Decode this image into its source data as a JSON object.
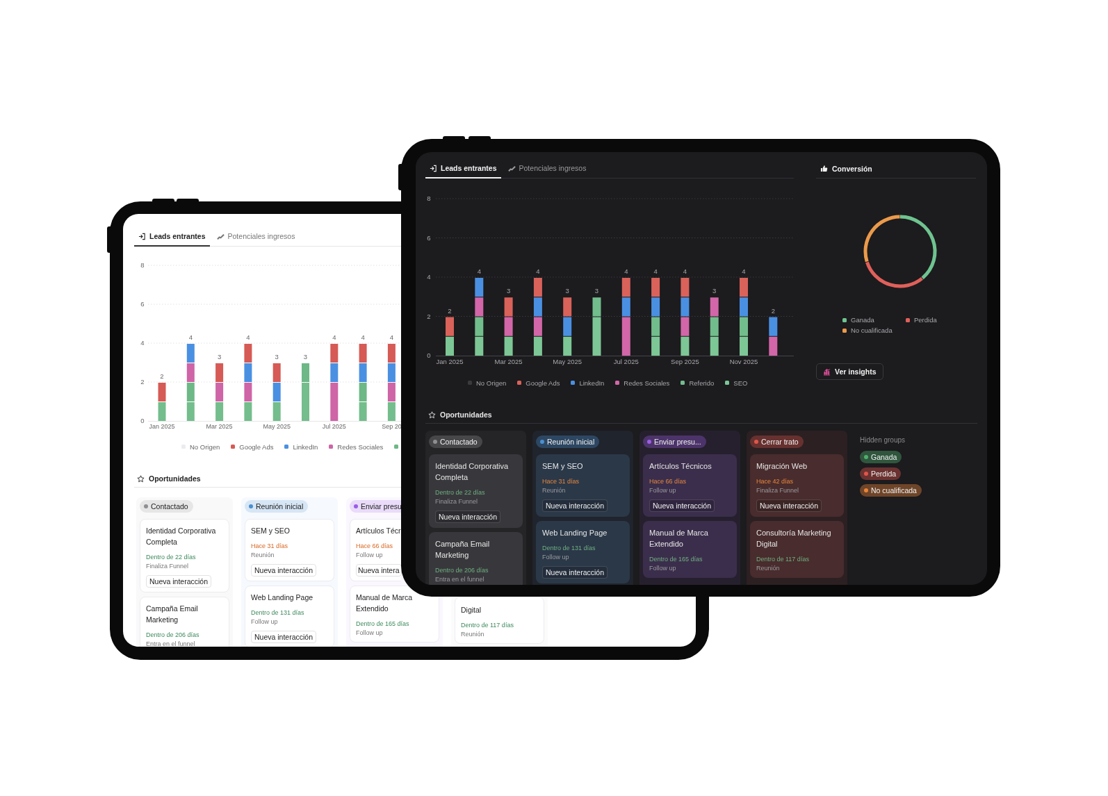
{
  "devices": [
    {
      "kind": "light",
      "tabs": [
        {
          "label": "Leads entrantes",
          "selected": true
        },
        {
          "label": "Potenciales ingresos",
          "selected": false
        }
      ],
      "chart": {
        "chart_data": {
          "type": "bar",
          "stacked": true,
          "grid": true,
          "legend": "bottom",
          "categories": [
            "Jan 2025",
            null,
            "Mar 2025",
            null,
            "May 2025",
            null,
            "Jul 2025",
            null,
            "Sep 20"
          ],
          "value_labels": [
            "2",
            "4",
            "3",
            "4",
            "3",
            "3",
            "4",
            "4",
            "4"
          ],
          "ylim": [
            0,
            8
          ],
          "yticks": [
            0,
            2,
            4,
            6,
            8
          ],
          "series": [
            {
              "name": "No Origen",
              "color": "#ececf0",
              "values": [
                0,
                0,
                0,
                0,
                0,
                0,
                0,
                0,
                0
              ]
            },
            {
              "name": "Google Ads",
              "color": "#d65a55",
              "values": [
                1,
                0,
                1,
                1,
                1,
                0,
                1,
                1,
                1
              ]
            },
            {
              "name": "LinkedIn",
              "color": "#4a90e2",
              "values": [
                0,
                1,
                0,
                1,
                1,
                0,
                1,
                1,
                1
              ]
            },
            {
              "name": "Redes Sociales",
              "color": "#cf64a6",
              "values": [
                0,
                1,
                1,
                1,
                0,
                0,
                2,
                0,
                1
              ]
            },
            {
              "color": "#6db886",
              "values": [
                0,
                1,
                0,
                0,
                0,
                1,
                0,
                1,
                0
              ]
            },
            {
              "color": "#74bd8c",
              "values": [
                1,
                1,
                1,
                1,
                1,
                2,
                0,
                1,
                1
              ]
            }
          ]
        }
      },
      "opportunities": {
        "title": "Oportunidades",
        "columns": [
          {
            "label": "Contactado",
            "color": "#8e8e93",
            "cards": [
              {
                "title": "Identidad Corporativa Completa",
                "due": {
                  "kind": "upcoming",
                  "text": "Dentro de 22 días"
                },
                "note": "Finaliza Funnel",
                "button": "Nueva interacción"
              },
              {
                "title": "Campaña Email Marketing",
                "due": {
                  "kind": "upcoming",
                  "text": "Dentro de 206 días"
                },
                "note": "Entra en el funnel"
              }
            ]
          },
          {
            "label": "Reunión inicial",
            "color": "#4a8fd0",
            "cards": [
              {
                "title": "SEM y SEO",
                "due": {
                  "kind": "overdue",
                  "text": "Hace 31 días"
                },
                "note": "Reunión",
                "button": "Nueva interacción"
              },
              {
                "title": "Web Landing Page",
                "due": {
                  "kind": "upcoming",
                  "text": "Dentro de 131 días"
                },
                "note": "Follow up",
                "button": "Nueva interacción"
              }
            ]
          },
          {
            "label": "Enviar presu",
            "color": "#9b5de5",
            "cards": [
              {
                "title": "Artículos Técr",
                "due": {
                  "kind": "overdue",
                  "text": "Hace 66 días"
                },
                "note": "Follow up",
                "button": "Nueva intera"
              },
              {
                "title": "Manual de Marca Extendido",
                "due": {
                  "kind": "upcoming",
                  "text": "Dentro de 165 días"
                },
                "note": "Follow up"
              }
            ]
          },
          {
            "cards": [
              {
                "title": "Digital",
                "due": {
                  "kind": "upcoming",
                  "text": "Dentro de 117 días"
                },
                "note": "Reunión"
              }
            ]
          }
        ]
      }
    },
    {
      "kind": "dark",
      "tabs": [
        {
          "label": "Leads entrantes",
          "selected": true
        },
        {
          "label": "Potenciales ingresos",
          "selected": false
        }
      ],
      "chart": {
        "chart_data": {
          "type": "bar",
          "stacked": true,
          "grid": true,
          "legend": "bottom",
          "categories": [
            "Jan 2025",
            null,
            "Mar 2025",
            null,
            "May 2025",
            null,
            "Jul 2025",
            null,
            "Sep 2025",
            null,
            "Nov 2025",
            null
          ],
          "value_labels": [
            "2",
            "4",
            "3",
            "4",
            "3",
            "3",
            "4",
            "4",
            "4",
            "3",
            "4",
            "2"
          ],
          "ylim": [
            0,
            8
          ],
          "yticks": [
            0,
            2,
            4,
            6,
            8
          ],
          "series": [
            {
              "name": "No Origen",
              "color": "#3a3a3e",
              "values": [
                0,
                0,
                0,
                0,
                0,
                0,
                0,
                0,
                0,
                0,
                0,
                0
              ]
            },
            {
              "name": "Google Ads",
              "color": "#d9625a",
              "values": [
                1,
                0,
                1,
                1,
                1,
                0,
                1,
                1,
                1,
                0,
                1,
                0
              ]
            },
            {
              "name": "LinkedIn",
              "color": "#4a90e2",
              "values": [
                0,
                1,
                0,
                1,
                1,
                0,
                1,
                1,
                1,
                0,
                1,
                1
              ]
            },
            {
              "name": "Redes Sociales",
              "color": "#d266a8",
              "values": [
                0,
                1,
                1,
                1,
                0,
                0,
                2,
                0,
                1,
                1,
                0,
                1
              ]
            },
            {
              "name": "Referido",
              "color": "#72bd8c",
              "values": [
                0,
                1,
                0,
                0,
                0,
                1,
                0,
                1,
                0,
                1,
                1,
                0
              ]
            },
            {
              "name": "SEO",
              "color": "#7cc795",
              "values": [
                1,
                1,
                1,
                1,
                1,
                2,
                0,
                1,
                1,
                1,
                1,
                0
              ]
            }
          ]
        }
      },
      "conversion": {
        "title": "Conversión",
        "legend": [
          {
            "label": "Ganada",
            "color": "#6fc48f"
          },
          {
            "label": "Perdida",
            "color": "#e0605a"
          },
          {
            "label": "No cualificada",
            "color": "#eb9a4a"
          }
        ],
        "button": "Ver insights"
      },
      "opportunities": {
        "title": "Oportunidades",
        "columns": [
          {
            "label": "Contactado",
            "color": "#8e8e93",
            "cards": [
              {
                "title": "Identidad Corporativa Completa",
                "due": {
                  "kind": "upcoming",
                  "text": "Dentro de 22 días"
                },
                "note": "Finaliza Funnel",
                "button": "Nueva interacción"
              },
              {
                "title": "Campaña Email Marketing",
                "due": {
                  "kind": "upcoming",
                  "text": "Dentro de 206 días"
                },
                "note": "Entra en el funnel"
              }
            ]
          },
          {
            "label": "Reunión inicial",
            "color": "#4a8fd0",
            "cards": [
              {
                "title": "SEM y SEO",
                "due": {
                  "kind": "overdue",
                  "text": "Hace 31 días"
                },
                "note": "Reunión",
                "button": "Nueva interacción"
              },
              {
                "title": "Web Landing Page",
                "due": {
                  "kind": "upcoming",
                  "text": "Dentro de 131 días"
                },
                "note": "Follow up",
                "button": "Nueva interacción"
              }
            ]
          },
          {
            "label": "Enviar presu...",
            "color": "#9b5de5",
            "cards": [
              {
                "title": "Artículos Técnicos",
                "due": {
                  "kind": "overdue",
                  "text": "Hace 66 días"
                },
                "note": "Follow up",
                "button": "Nueva interacción"
              },
              {
                "title": "Manual de Marca Extendido",
                "due": {
                  "kind": "upcoming",
                  "text": "Dentro de 165 días"
                },
                "note": "Follow up"
              }
            ]
          },
          {
            "label": "Cerrar trato",
            "color": "#e0554a",
            "cards": [
              {
                "title": "Migración Web",
                "due": {
                  "kind": "overdue",
                  "text": "Hace 42 días"
                },
                "note": "Finaliza Funnel",
                "button": "Nueva interacción"
              },
              {
                "title": "Consultoría Marketing Digital",
                "due": {
                  "kind": "upcoming",
                  "text": "Dentro de 117 días"
                },
                "note": "Reunión"
              }
            ]
          }
        ],
        "hidden_groups": {
          "title": "Hidden groups",
          "items": [
            {
              "label": "Ganada",
              "color": "#4fae6e"
            },
            {
              "label": "Perdida",
              "color": "#e0554a"
            },
            {
              "label": "No cualificada",
              "color": "#e8843a"
            }
          ]
        }
      }
    }
  ]
}
